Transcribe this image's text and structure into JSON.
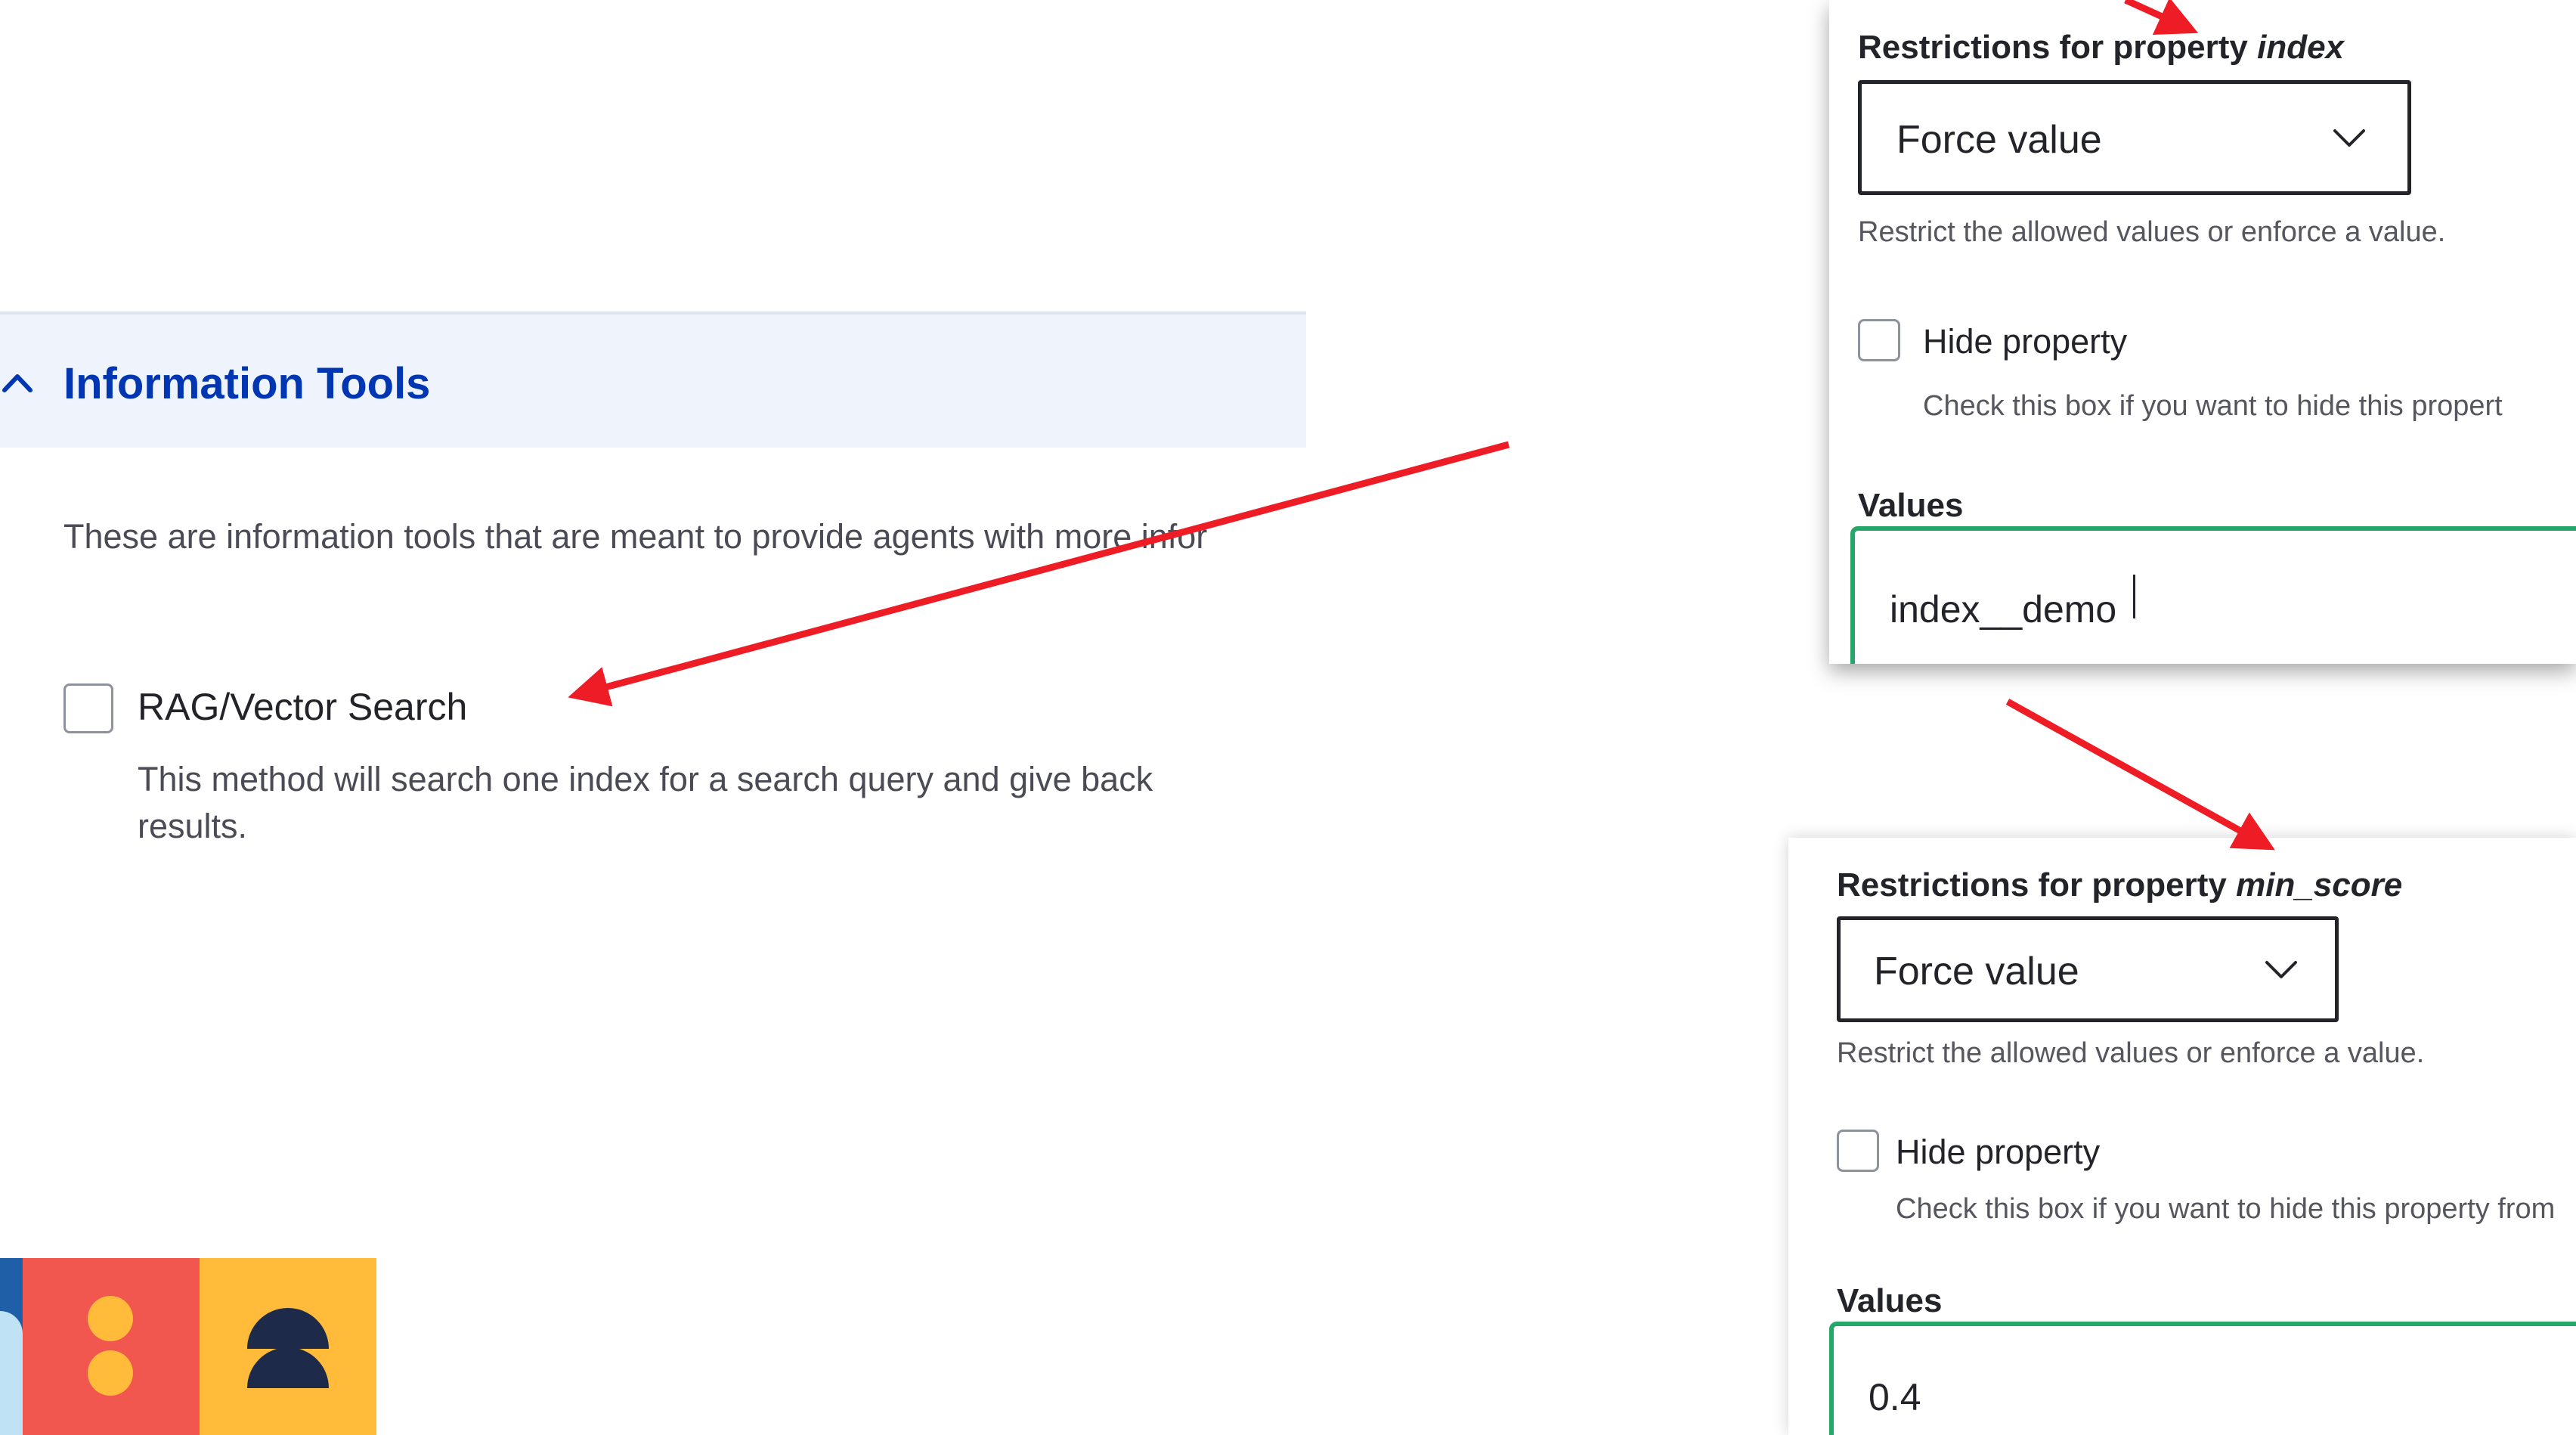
{
  "left": {
    "section_title": "Information Tools",
    "section_description": "These are information tools that are meant to provide agents with more infor",
    "tool": {
      "label": "RAG/Vector Search",
      "checked": false,
      "description": "This method will search one index for a search query and give back results."
    }
  },
  "panel_index": {
    "heading_prefix": "Restrictions for property ",
    "property": "index",
    "select_value": "Force value",
    "select_help": "Restrict the allowed values or enforce a value.",
    "hide_label": "Hide property",
    "hide_checked": false,
    "hide_help": "Check this box if you want to hide this propert",
    "values_label": "Values",
    "values_input": "index__demo"
  },
  "panel_min_score": {
    "heading_prefix": "Restrictions for property ",
    "property": "min_score",
    "select_value": "Force value",
    "select_help": "Restrict the allowed values or enforce a value.",
    "hide_label": "Hide property",
    "hide_checked": false,
    "hide_help": "Check this box if you want to hide this property from",
    "values_label": "Values",
    "values_input": "0.4"
  },
  "colors": {
    "accent_blue": "#0036b1",
    "header_bg": "#eff4fc",
    "arrow_red": "#ee1c25",
    "input_focus_green": "#26a769",
    "logo_red": "#f2574f",
    "logo_yellow": "#ffbb39",
    "logo_navy": "#1d2a4a"
  },
  "icons": [
    "chevron-up-icon",
    "chevron-down-icon",
    "annotation-arrow"
  ]
}
